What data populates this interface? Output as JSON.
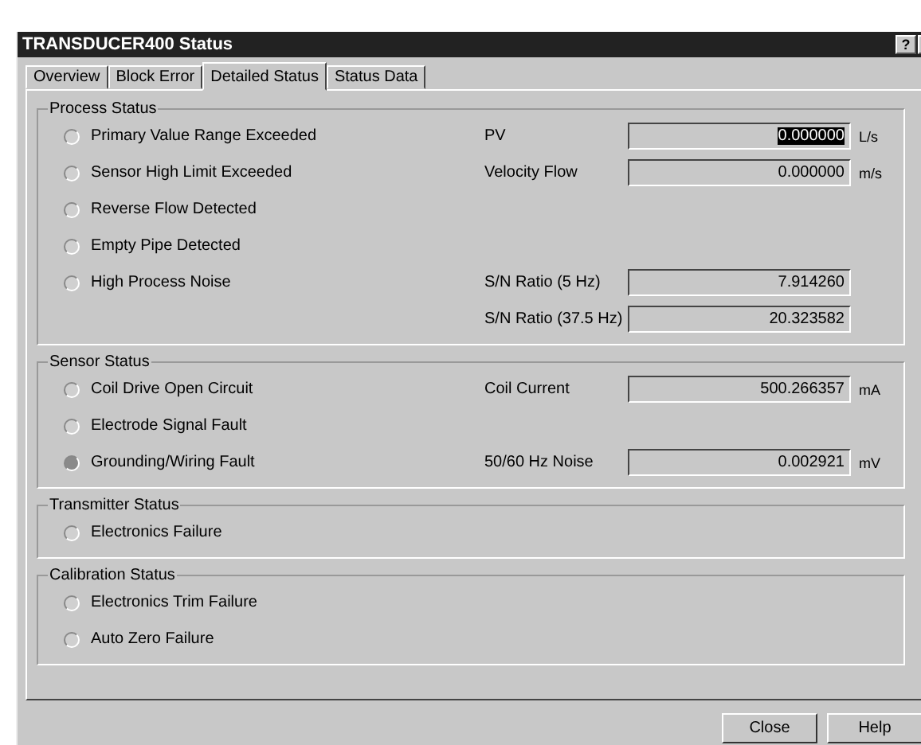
{
  "window": {
    "title": "TRANSDUCER400 Status",
    "help": "?"
  },
  "tabs": [
    {
      "label": "Overview",
      "selected": false
    },
    {
      "label": "Block Error",
      "selected": false
    },
    {
      "label": "Detailed Status",
      "selected": true
    },
    {
      "label": "Status Data",
      "selected": false
    }
  ],
  "groups": [
    {
      "title": "Process Status",
      "rows": [
        {
          "indicator": {
            "label": "Primary Value Range Exceeded",
            "active": false
          },
          "field": {
            "label": "PV",
            "value": "0.000000",
            "unit": "L/s",
            "highlighted": true
          }
        },
        {
          "indicator": {
            "label": "Sensor High Limit Exceeded",
            "active": false
          },
          "field": {
            "label": "Velocity Flow",
            "value": "0.000000",
            "unit": "m/s",
            "highlighted": false
          }
        },
        {
          "indicator": {
            "label": "Reverse Flow Detected",
            "active": false
          }
        },
        {
          "indicator": {
            "label": "Empty Pipe Detected",
            "active": false
          }
        },
        {
          "indicator": {
            "label": "High Process Noise",
            "active": false
          },
          "field": {
            "label": "S/N Ratio (5 Hz)",
            "value": "7.914260",
            "highlighted": false
          }
        },
        {
          "field": {
            "label": "S/N Ratio (37.5 Hz)",
            "value": "20.323582",
            "highlighted": false
          }
        }
      ]
    },
    {
      "title": "Sensor Status",
      "rows": [
        {
          "indicator": {
            "label": "Coil Drive Open Circuit",
            "active": false
          },
          "field": {
            "label": "Coil Current",
            "value": "500.266357",
            "unit": "mA",
            "highlighted": false
          }
        },
        {
          "indicator": {
            "label": "Electrode Signal Fault",
            "active": false
          }
        },
        {
          "indicator": {
            "label": "Grounding/Wiring Fault",
            "active": true
          },
          "field": {
            "label": "50/60 Hz Noise",
            "value": "0.002921",
            "unit": "mV",
            "highlighted": false
          }
        }
      ]
    },
    {
      "title": "Transmitter Status",
      "rows": [
        {
          "indicator": {
            "label": "Electronics Failure",
            "active": false
          }
        }
      ]
    },
    {
      "title": "Calibration Status",
      "rows": [
        {
          "indicator": {
            "label": "Electronics Trim Failure",
            "active": false
          }
        },
        {
          "indicator": {
            "label": "Auto Zero Failure",
            "active": false
          }
        }
      ]
    }
  ],
  "buttons": [
    "Close",
    "Help"
  ]
}
